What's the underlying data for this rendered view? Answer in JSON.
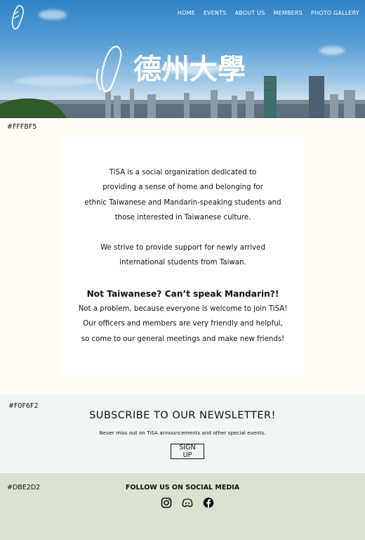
{
  "nav": {
    "items": [
      {
        "label": "HOME"
      },
      {
        "label": "EVENTS"
      },
      {
        "label": "ABOUT US"
      },
      {
        "label": "MEMBERS"
      },
      {
        "label": "PHOTO GALLERY"
      }
    ]
  },
  "hero": {
    "title_characters": "德州大學"
  },
  "swatches": {
    "intro": "#FFFBF5",
    "newsletter": "#F0F6F2",
    "social": "#DBE2D2"
  },
  "intro": {
    "para1_lines": [
      "TiSA is a social organization dedicated to",
      "providing a sense of home and belonging for",
      "ethnic Taiwanese and Mandarin-speaking students and",
      "those interested in Taiwanese culture."
    ],
    "para2_lines": [
      "We strive to provide support for newly arrived",
      "international students from Taiwan."
    ],
    "question": "Not Taiwanese? Can’t speak Mandarin?!",
    "para3_lines": [
      "Not a problem, because everyone is welcome to join TiSA!",
      "Our officers and members are very friendly and helpful,",
      "so come to our general meetings and make new friends!"
    ]
  },
  "newsletter": {
    "title": "SUBSCRIBE TO OUR NEWSLETTER!",
    "subtitle": "Never miss out on TiSA announcements and other special events.",
    "button_label": "SIGN UP"
  },
  "social": {
    "title": "FOLLOW US ON SOCIAL MEDIA",
    "icons": [
      "instagram-icon",
      "discord-icon",
      "facebook-icon"
    ]
  },
  "colors": {
    "hero_sky": "#5aa0d6",
    "intro_bg": "#FFFBF5",
    "card_bg": "#FFFFFF",
    "newsletter_bg": "#F0F6F2",
    "social_bg": "#DBE2D2",
    "text": "#111111"
  }
}
